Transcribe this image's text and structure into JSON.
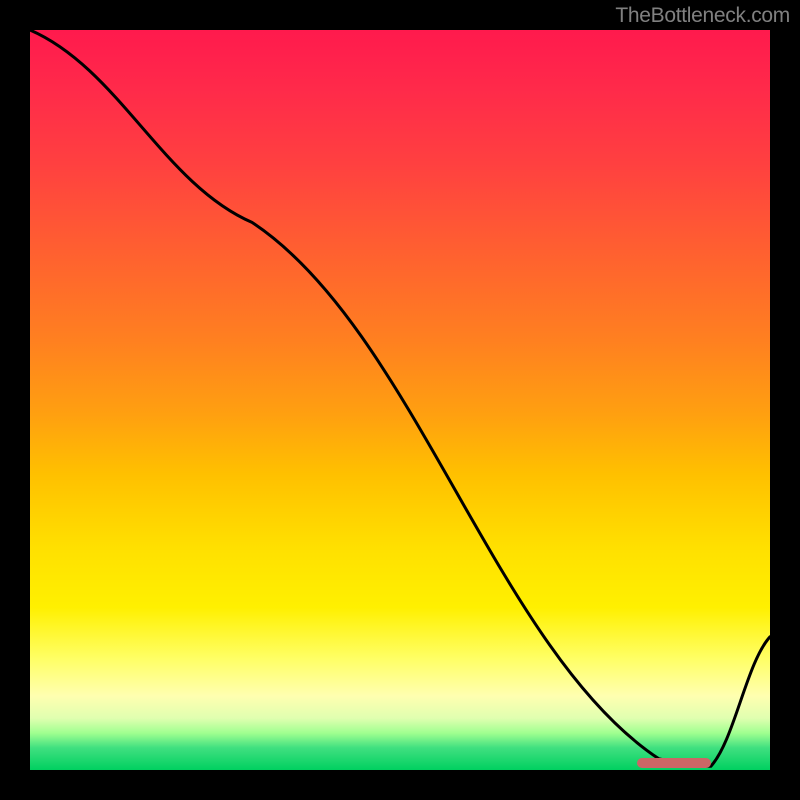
{
  "watermark": "TheBottleneck.com",
  "chart_data": {
    "type": "line",
    "title": "",
    "xlabel": "",
    "ylabel": "",
    "x": [
      0,
      0.3,
      0.85,
      0.88,
      0.92,
      1.0
    ],
    "y": [
      1.0,
      0.74,
      0.015,
      0.005,
      0.005,
      0.18
    ],
    "xlim": [
      0,
      1
    ],
    "ylim": [
      0,
      1
    ],
    "marker": {
      "x_start": 0.82,
      "x_end": 0.92,
      "y": 0.01,
      "color": "#cc6666"
    },
    "background_gradient": {
      "top": "#ff1a4d",
      "upper_mid": "#ffa000",
      "lower_mid": "#ffff40",
      "bottom": "#00d060"
    }
  }
}
